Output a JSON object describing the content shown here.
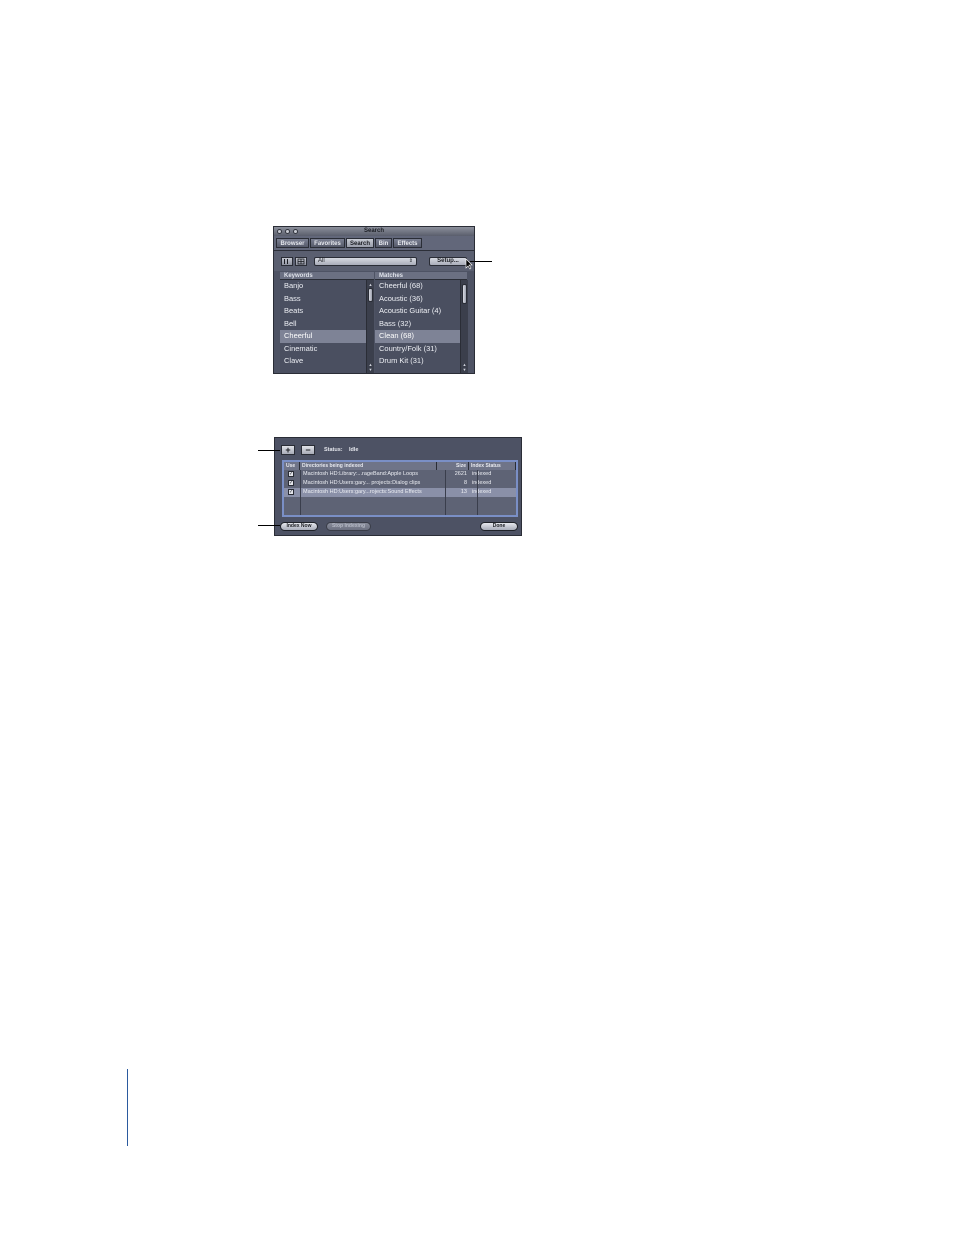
{
  "search_window": {
    "title": "Search",
    "tabs": [
      {
        "label": "Browser",
        "active": false
      },
      {
        "label": "Favorites",
        "active": false
      },
      {
        "label": "Search",
        "active": true
      },
      {
        "label": "Bin",
        "active": false
      },
      {
        "label": "Effects",
        "active": false
      }
    ],
    "view_buttons": [
      "list-view-icon",
      "grid-view-icon"
    ],
    "filter_select_value": "All",
    "setup_label": "Setup...",
    "keywords_header": "Keywords",
    "matches_header": "Matches",
    "keywords": [
      "Banjo",
      "Bass",
      "Beats",
      "Bell",
      "Cheerful",
      "Cinematic",
      "Clave"
    ],
    "selected_keyword": "Cheerful",
    "matches": [
      "Cheerful (68)",
      "Acoustic (36)",
      "Acoustic Guitar (4)",
      "Bass (32)",
      "Clean (68)",
      "Country/Folk (31)",
      "Drum Kit (31)"
    ],
    "selected_match": "Clean (68)"
  },
  "index_window": {
    "add_icon": "plus-icon",
    "remove_icon": "minus-icon",
    "add_label": "+",
    "remove_label": "−",
    "status_label": "Status:",
    "status_value": "Idle",
    "columns": [
      "Use",
      "Directories being indexed",
      "Size",
      "Index Status"
    ],
    "rows": [
      {
        "checked": true,
        "directory": "Macintosh HD:Library:...rageBand:Apple Loops",
        "size": "2621",
        "status": "indexed"
      },
      {
        "checked": true,
        "directory": "Macintosh HD:Users:gary... projects:Dialog clips",
        "size": "8",
        "status": "indexed"
      },
      {
        "checked": true,
        "directory": "Macintosh HD:Users:gary...rojects:Sound Effects",
        "size": "13",
        "status": "indexed"
      }
    ],
    "index_now_label": "Index Now",
    "stop_indexing_label": "Stop Indexing",
    "done_label": "Done"
  },
  "colors": {
    "window_bg": "#4e5364",
    "selection": "#7e8396",
    "table_focus_ring": "#7a8fc6",
    "page_rule": "#2b5a9e"
  }
}
